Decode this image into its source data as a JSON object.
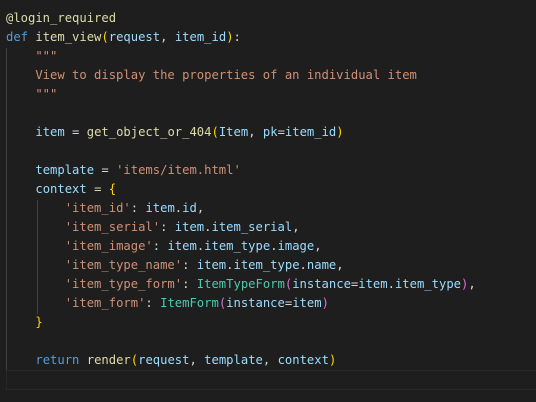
{
  "lines": [
    [
      {
        "t": "@login_required",
        "c": "c-dec"
      }
    ],
    [
      {
        "t": "def",
        "c": "c-kw"
      },
      {
        "t": " "
      },
      {
        "t": "item_view",
        "c": "c-fn"
      },
      {
        "t": "(",
        "c": "b1"
      },
      {
        "t": "request",
        "c": "c-par"
      },
      {
        "t": ", "
      },
      {
        "t": "item_id",
        "c": "c-par"
      },
      {
        "t": ")",
        "c": "b1"
      },
      {
        "t": ":"
      }
    ],
    [
      {
        "t": "    \"\"\"",
        "c": "c-str"
      }
    ],
    [
      {
        "t": "    View to display the properties of an individual item",
        "c": "c-str"
      }
    ],
    [
      {
        "t": "    \"\"\"",
        "c": "c-str"
      }
    ],
    [],
    [
      {
        "t": "    "
      },
      {
        "t": "item",
        "c": "c-par"
      },
      {
        "t": " = "
      },
      {
        "t": "get_object_or_404",
        "c": "c-fn"
      },
      {
        "t": "(",
        "c": "b1"
      },
      {
        "t": "Item",
        "c": "c-par"
      },
      {
        "t": ", "
      },
      {
        "t": "pk",
        "c": "c-par"
      },
      {
        "t": "="
      },
      {
        "t": "item_id",
        "c": "c-par"
      },
      {
        "t": ")",
        "c": "b1"
      }
    ],
    [],
    [
      {
        "t": "    "
      },
      {
        "t": "template",
        "c": "c-par"
      },
      {
        "t": " = "
      },
      {
        "t": "'items/item.html'",
        "c": "c-str"
      }
    ],
    [
      {
        "t": "    "
      },
      {
        "t": "context",
        "c": "c-par"
      },
      {
        "t": " = "
      },
      {
        "t": "{",
        "c": "b1"
      }
    ],
    [
      {
        "t": "        "
      },
      {
        "t": "'item_id'",
        "c": "c-str"
      },
      {
        "t": ": "
      },
      {
        "t": "item",
        "c": "c-par"
      },
      {
        "t": "."
      },
      {
        "t": "id",
        "c": "c-par"
      },
      {
        "t": ","
      }
    ],
    [
      {
        "t": "        "
      },
      {
        "t": "'item_serial'",
        "c": "c-str"
      },
      {
        "t": ": "
      },
      {
        "t": "item",
        "c": "c-par"
      },
      {
        "t": "."
      },
      {
        "t": "item_serial",
        "c": "c-par"
      },
      {
        "t": ","
      }
    ],
    [
      {
        "t": "        "
      },
      {
        "t": "'item_image'",
        "c": "c-str"
      },
      {
        "t": ": "
      },
      {
        "t": "item",
        "c": "c-par"
      },
      {
        "t": "."
      },
      {
        "t": "item_type",
        "c": "c-par"
      },
      {
        "t": "."
      },
      {
        "t": "image",
        "c": "c-par"
      },
      {
        "t": ","
      }
    ],
    [
      {
        "t": "        "
      },
      {
        "t": "'item_type_name'",
        "c": "c-str"
      },
      {
        "t": ": "
      },
      {
        "t": "item",
        "c": "c-par"
      },
      {
        "t": "."
      },
      {
        "t": "item_type",
        "c": "c-par"
      },
      {
        "t": "."
      },
      {
        "t": "name",
        "c": "c-par"
      },
      {
        "t": ","
      }
    ],
    [
      {
        "t": "        "
      },
      {
        "t": "'item_type_form'",
        "c": "c-str"
      },
      {
        "t": ": "
      },
      {
        "t": "ItemTypeForm",
        "c": "c-cls"
      },
      {
        "t": "(",
        "c": "b2"
      },
      {
        "t": "instance",
        "c": "c-par"
      },
      {
        "t": "="
      },
      {
        "t": "item",
        "c": "c-par"
      },
      {
        "t": "."
      },
      {
        "t": "item_type",
        "c": "c-par"
      },
      {
        "t": ")",
        "c": "b2"
      },
      {
        "t": ","
      }
    ],
    [
      {
        "t": "        "
      },
      {
        "t": "'item_form'",
        "c": "c-str"
      },
      {
        "t": ": "
      },
      {
        "t": "ItemForm",
        "c": "c-cls"
      },
      {
        "t": "(",
        "c": "b2"
      },
      {
        "t": "instance",
        "c": "c-par"
      },
      {
        "t": "="
      },
      {
        "t": "item",
        "c": "c-par"
      },
      {
        "t": ")",
        "c": "b2"
      }
    ],
    [
      {
        "t": "    "
      },
      {
        "t": "}",
        "c": "b1"
      }
    ],
    [],
    [
      {
        "t": "    "
      },
      {
        "t": "return",
        "c": "c-kw"
      },
      {
        "t": " "
      },
      {
        "t": "render",
        "c": "c-fn"
      },
      {
        "t": "(",
        "c": "b1"
      },
      {
        "t": "request",
        "c": "c-par"
      },
      {
        "t": ", "
      },
      {
        "t": "template",
        "c": "c-par"
      },
      {
        "t": ", "
      },
      {
        "t": "context",
        "c": "c-par"
      },
      {
        "t": ")",
        "c": "b1"
      }
    ]
  ]
}
